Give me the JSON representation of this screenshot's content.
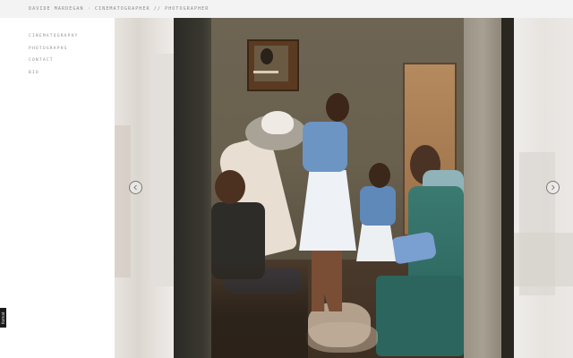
{
  "header": {
    "site_title": "DAVIDE MARDEGAN · CINEMATOGRAPHER // PHOTOGRAPHER"
  },
  "sidebar": {
    "items": [
      {
        "label": "CINEMATOGRAPHY"
      },
      {
        "label": "PHOTOGRAPHS"
      },
      {
        "label": "CONTACT"
      },
      {
        "label": "BIO"
      }
    ]
  },
  "gallery": {
    "prev_icon": "chevron-left-icon",
    "next_icon": "chevron-right-icon"
  },
  "badge": {
    "label": "format"
  },
  "colors": {
    "topbar_bg": "#f3f3f3",
    "nav_text": "#8f8f8f",
    "page_bg": "#ffffff"
  }
}
